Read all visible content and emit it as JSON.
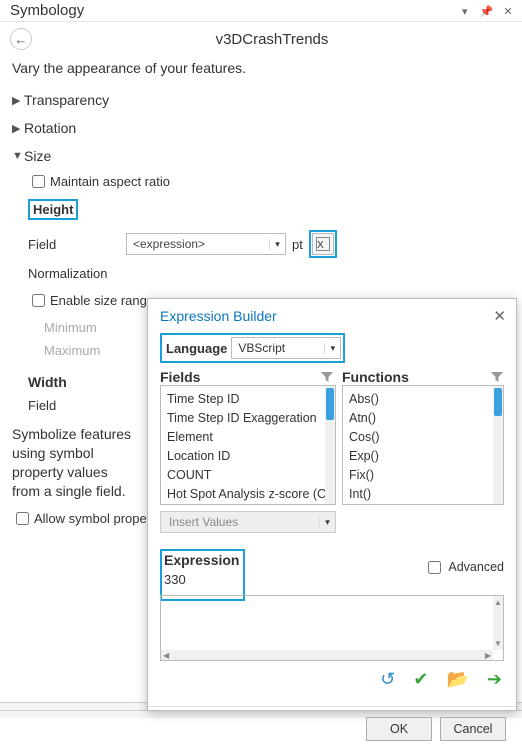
{
  "pane": {
    "title": "Symbology",
    "layer": "v3DCrashTrends",
    "instruction": "Vary the appearance of your features."
  },
  "sections": {
    "transparency": "Transparency",
    "rotation": "Rotation",
    "size": "Size"
  },
  "size": {
    "maintain_label": "Maintain aspect ratio",
    "height_label": "Height",
    "field_label": "Field",
    "field_value": "<expression>",
    "unit": "pt",
    "normalization_label": "Normalization",
    "enable_range_label": "Enable size range",
    "min_label": "Minimum",
    "max_label": "Maximum",
    "width_label": "Width",
    "width_field_label": "Field"
  },
  "bottom": {
    "text": "Symbolize features using symbol property values from a single field.",
    "allow_prop_label": "Allow symbol property connections"
  },
  "dlg": {
    "title": "Expression Builder",
    "language_label": "Language",
    "language_value": "VBScript",
    "fields_label": "Fields",
    "functions_label": "Functions",
    "fields": [
      "Time Step ID",
      "Time Step ID Exaggeration",
      "Element",
      "Location ID",
      "COUNT",
      "Hot Spot Analysis z-score (COUNT)"
    ],
    "functions": [
      "Abs()",
      "Atn()",
      "Cos()",
      "Exp()",
      "Fix()",
      "Int()"
    ],
    "insert_label": "Insert Values",
    "expression_label": "Expression",
    "expression_value": "330",
    "advanced_label": "Advanced",
    "ok": "OK",
    "cancel": "Cancel"
  }
}
